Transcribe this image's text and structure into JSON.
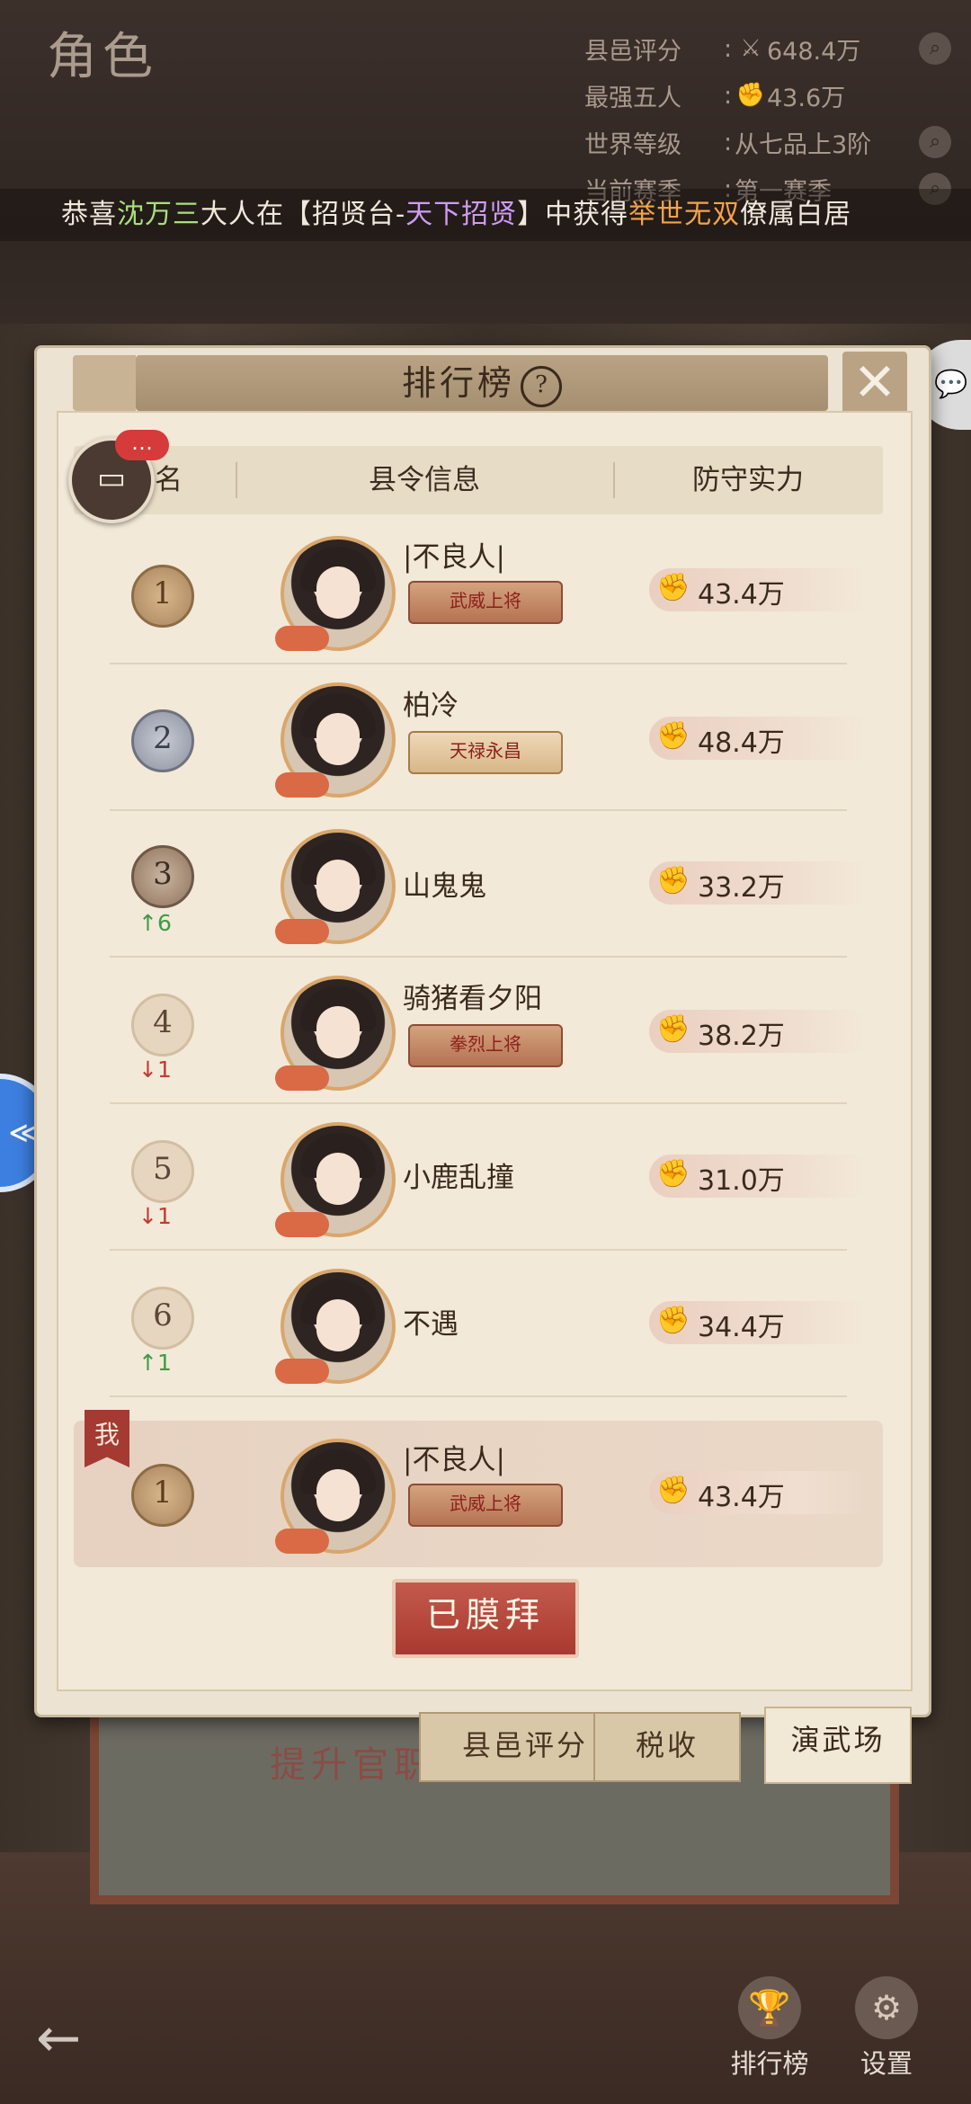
{
  "page": {
    "title": "角色"
  },
  "stats": [
    {
      "label": "县邑评分",
      "icon": "crossed-swords-icon",
      "value": "648.4万"
    },
    {
      "label": "最强五人",
      "icon": "fist-icon",
      "value": "43.6万"
    },
    {
      "label": "世界等级",
      "icon": "",
      "value": "从七品上3阶"
    },
    {
      "label": "当前赛季",
      "icon": "",
      "value": "第一赛季"
    }
  ],
  "marquee": {
    "p1": "恭喜",
    "name": "沈万三",
    "p2": "大人在【招贤台-",
    "event": "天下招贤",
    "p3": "】中获得",
    "item": "举世无双",
    "p4": "僚属白居"
  },
  "panel": {
    "title": "排行榜",
    "help": "?",
    "close": "✕"
  },
  "chat": {
    "badge": "…"
  },
  "columns": {
    "rank": "排名",
    "info": "县令信息",
    "power": "防守实力"
  },
  "rows": [
    {
      "rank": "1",
      "name": "|不良人|",
      "badge": "武威上将",
      "power": "43.4万",
      "trend": ""
    },
    {
      "rank": "2",
      "name": "柏冷",
      "badge": "天禄永昌",
      "power": "48.4万",
      "trend": ""
    },
    {
      "rank": "3",
      "name": "山鬼鬼",
      "badge": "",
      "power": "33.2万",
      "trend": "↑6"
    },
    {
      "rank": "4",
      "name": "骑猪看夕阳",
      "badge": "拳烈上将",
      "power": "38.2万",
      "trend": "↓1"
    },
    {
      "rank": "5",
      "name": "小鹿乱撞",
      "badge": "",
      "power": "31.0万",
      "trend": "↓1"
    },
    {
      "rank": "6",
      "name": "不遇",
      "badge": "",
      "power": "34.4万",
      "trend": "↑1"
    }
  ],
  "me": {
    "flag": "我",
    "rank": "1",
    "name": "|不良人|",
    "badge": "武威上将",
    "power": "43.4万"
  },
  "worship_button": "已膜拜",
  "tabs": [
    "县邑评分",
    "税收",
    "演武场"
  ],
  "under_text": "提升官职",
  "nav": [
    {
      "label": "排行榜",
      "icon": "trophy-icon"
    },
    {
      "label": "设置",
      "icon": "gear-icon"
    }
  ],
  "colors": {
    "accent_red": "#a9392f",
    "parchment": "#f2e9d8",
    "gold": "#d9a66b"
  }
}
